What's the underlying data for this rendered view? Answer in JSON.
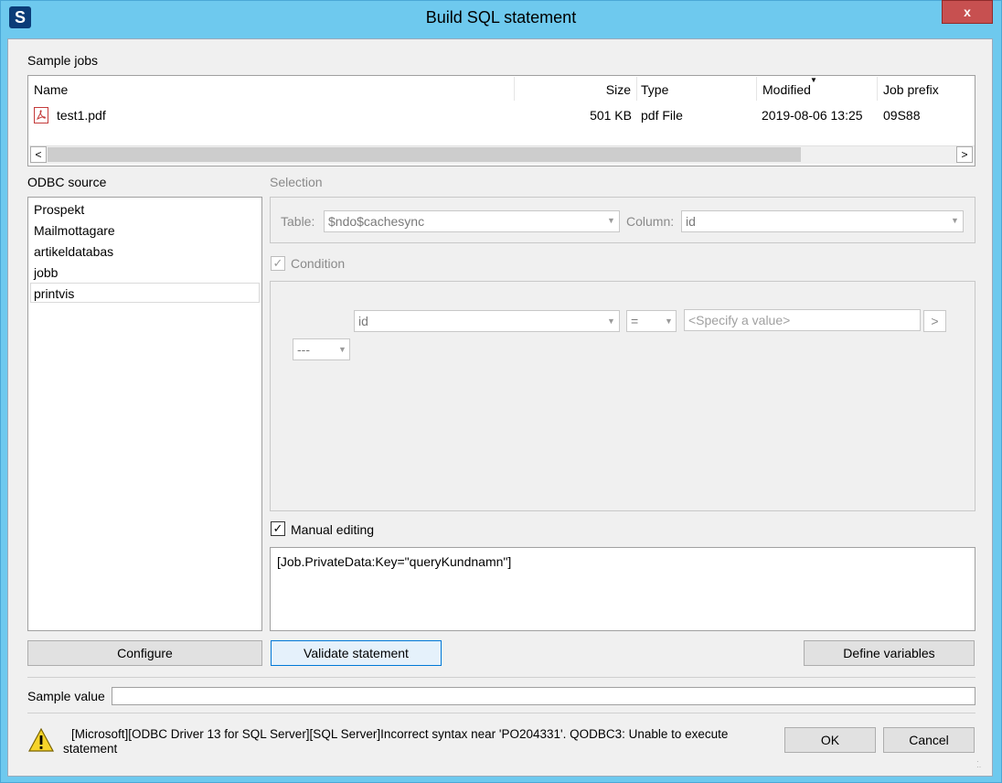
{
  "window": {
    "title": "Build SQL statement",
    "app_icon": "S",
    "close_label": "x"
  },
  "sample_jobs": {
    "label": "Sample jobs",
    "columns": [
      "Name",
      "Size",
      "Type",
      "Modified",
      "Job prefix"
    ],
    "rows": [
      {
        "name": "test1.pdf",
        "size": "501 KB",
        "type": "pdf File",
        "modified": "2019-08-06 13:25",
        "prefix": "09S88"
      }
    ]
  },
  "odbc": {
    "label": "ODBC source",
    "items": [
      "Prospekt",
      "Mailmottagare",
      "artikeldatabas",
      "jobb",
      "printvis"
    ],
    "selected": "printvis"
  },
  "selection": {
    "label": "Selection",
    "table_label": "Table:",
    "table_value": "$ndo$cachesync",
    "column_label": "Column:",
    "column_value": "id"
  },
  "condition": {
    "label": "Condition",
    "field": "id",
    "operator": "=",
    "value_placeholder": "<Specify a value>",
    "add_label": ">",
    "logic": "---"
  },
  "manual": {
    "label": "Manual editing",
    "text": "[Job.PrivateData:Key=\"queryKundnamn\"]"
  },
  "buttons": {
    "configure": "Configure",
    "validate": "Validate statement",
    "define": "Define variables",
    "ok": "OK",
    "cancel": "Cancel"
  },
  "sample_value": {
    "label": "Sample value",
    "value": ""
  },
  "error": {
    "line1": "[Microsoft][ODBC Driver 13 for SQL Server][SQL Server]Incorrect syntax near 'PO204331'. QODBC3: Unable to execute",
    "line2": "statement"
  }
}
